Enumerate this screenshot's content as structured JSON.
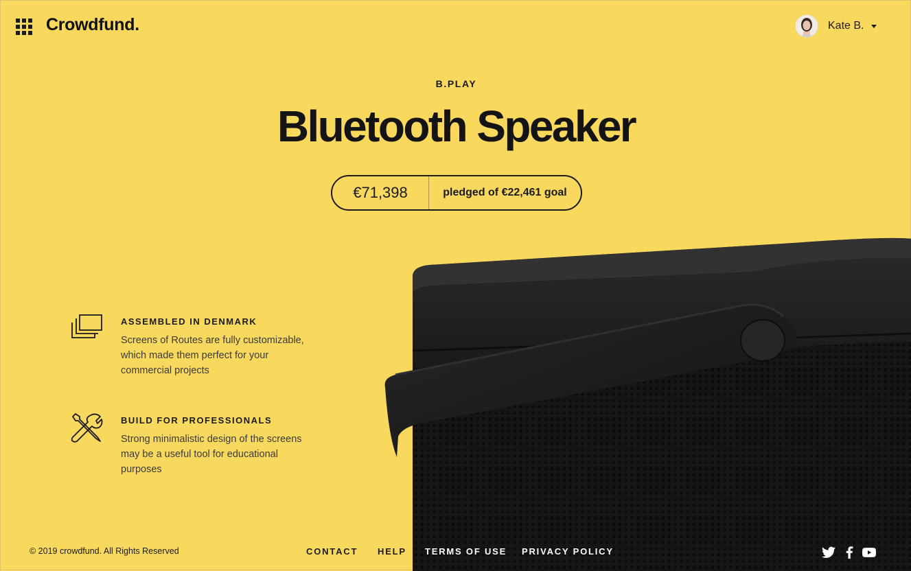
{
  "header": {
    "logo": "Crowdfund.",
    "user_name": "Kate B.",
    "menu_icon": "apps-grid-icon"
  },
  "hero": {
    "brand": "B.PLAY",
    "title": "Bluetooth Speaker",
    "pledged_amount": "€71,398",
    "pledged_text": "pledged of €22,461 goal"
  },
  "features": [
    {
      "icon": "stacked-screens-icon",
      "title": "ASSEMBLED IN DENMARK",
      "text": "Screens of Routes are fully customizable, which made them perfect for your commercial projects"
    },
    {
      "icon": "tools-icon",
      "title": "BUILD FOR PROFESSIONALS",
      "text": "Strong minimalistic design of the screens may be a useful tool for educational purposes"
    }
  ],
  "footer": {
    "copyright": "© 2019 crowdfund. All Rights Reserved",
    "links": [
      "CONTACT",
      "HELP",
      "TERMS OF USE",
      "PRIVACY POLICY"
    ],
    "social": [
      "twitter-icon",
      "facebook-icon",
      "youtube-icon"
    ]
  },
  "colors": {
    "background": "#F9D85E",
    "text": "#1a1a1a",
    "speaker": "#1c1c1c"
  }
}
